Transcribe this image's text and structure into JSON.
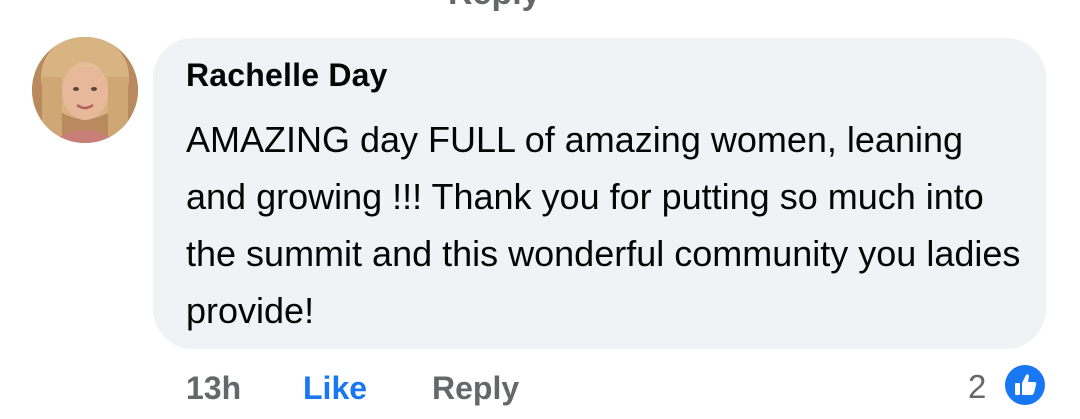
{
  "top_fragment": "Reply",
  "comment": {
    "author": "Rachelle Day",
    "text": "AMAZING day FULL of amazing women, leaning and growing !!! Thank you for putting so much into the summit and this wonderful community you ladies provide!",
    "avatar_icon": "user-avatar",
    "bubble_color": "#f0f2f5"
  },
  "actions": {
    "time": "13h",
    "like_label": "Like",
    "reply_label": "Reply"
  },
  "reactions": {
    "count": "2",
    "icon": "thumbs-up-icon",
    "accent_color": "#1877f2"
  }
}
